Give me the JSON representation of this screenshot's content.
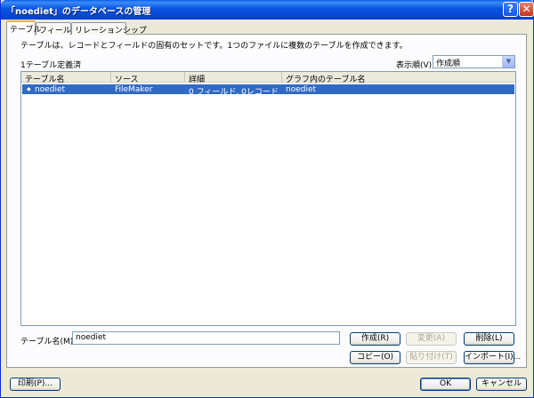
{
  "window": {
    "title": "「noediet」のデータベースの管理",
    "help_glyph": "?",
    "close_glyph": "✕"
  },
  "tabs": [
    {
      "label": "テーブル",
      "active": true
    },
    {
      "label": "フィールド",
      "active": false
    },
    {
      "label": "リレーションシップ",
      "active": false
    }
  ],
  "description": "テーブルは、レコードとフィールドの固有のセットです。1つのファイルに複数のテーブルを作成できます。",
  "count_text": "1テーブル定義済",
  "sort": {
    "label": "表示順(V):",
    "value": "作成順",
    "arrow": "▼"
  },
  "table": {
    "columns": [
      "テーブル名",
      "ソース",
      "詳細",
      "グラフ内のテーブル名"
    ],
    "rows": [
      {
        "icon": "◆",
        "name": "noediet",
        "source": "FileMaker",
        "details": "0 フィールド, 0レコード",
        "graph_name": "noediet",
        "selected": true
      }
    ]
  },
  "table_name": {
    "label": "テーブル名(M):",
    "value": "noediet"
  },
  "buttons": {
    "create": "作成(R)",
    "change": "変更(A)",
    "delete": "削除(L)",
    "copy": "コピー(O)",
    "paste": "貼り付け(T)",
    "import": "インポート(I)...",
    "print": "印刷(P)...",
    "ok": "OK",
    "cancel": "キャンセル"
  }
}
